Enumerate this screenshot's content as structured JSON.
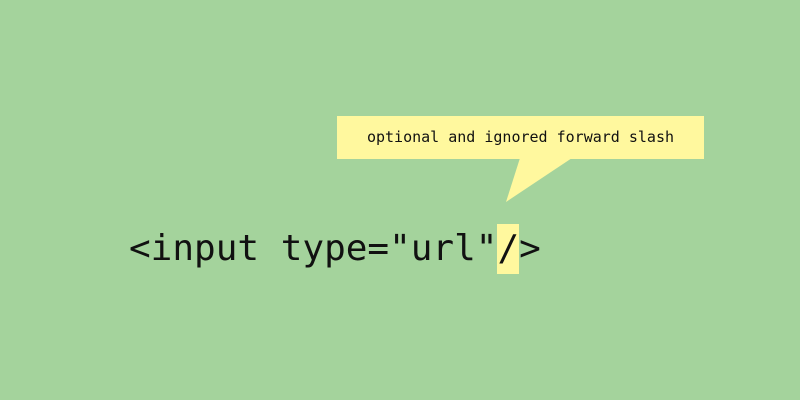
{
  "callout": {
    "text": "optional and ignored forward slash"
  },
  "code": {
    "before": "<input type=\"url\"",
    "highlighted": "/",
    "after": ">"
  },
  "colors": {
    "background": "#a4d39c",
    "highlight": "#fff89e",
    "text": "#111111"
  }
}
